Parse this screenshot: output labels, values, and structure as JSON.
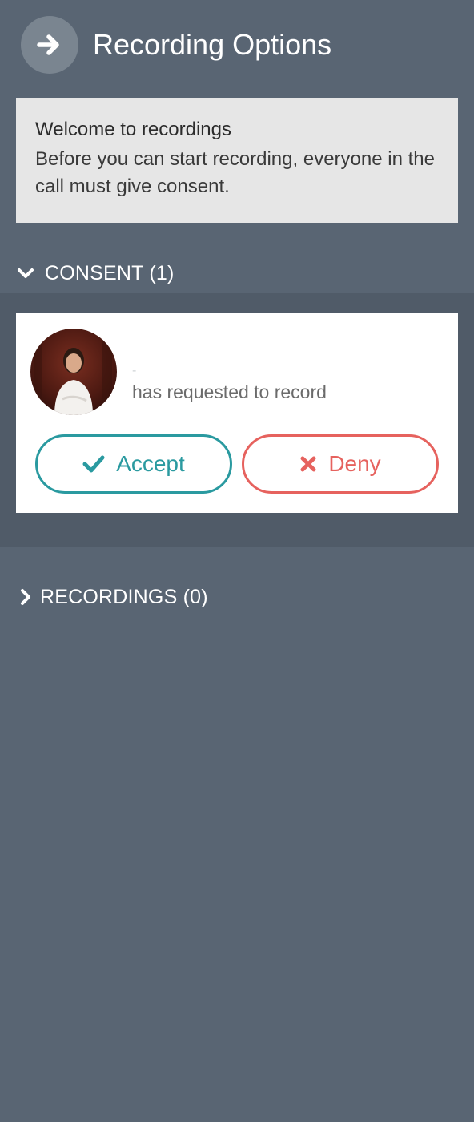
{
  "header": {
    "title": "Recording Options",
    "back_icon": "arrow-right-icon"
  },
  "welcome": {
    "title": "Welcome to recordings",
    "text": "Before you can start recording, everyone in the call must give consent."
  },
  "consent": {
    "label": "CONSENT (1)",
    "expanded": true,
    "request": {
      "name": "-",
      "text": "has requested to record"
    },
    "accept_label": "Accept",
    "deny_label": "Deny"
  },
  "recordings": {
    "label": "RECORDINGS (0)",
    "expanded": false
  },
  "colors": {
    "background": "#596573",
    "accent_accept": "#2a9aa0",
    "accent_deny": "#e6625e",
    "welcome_bg": "#e6e6e6"
  }
}
